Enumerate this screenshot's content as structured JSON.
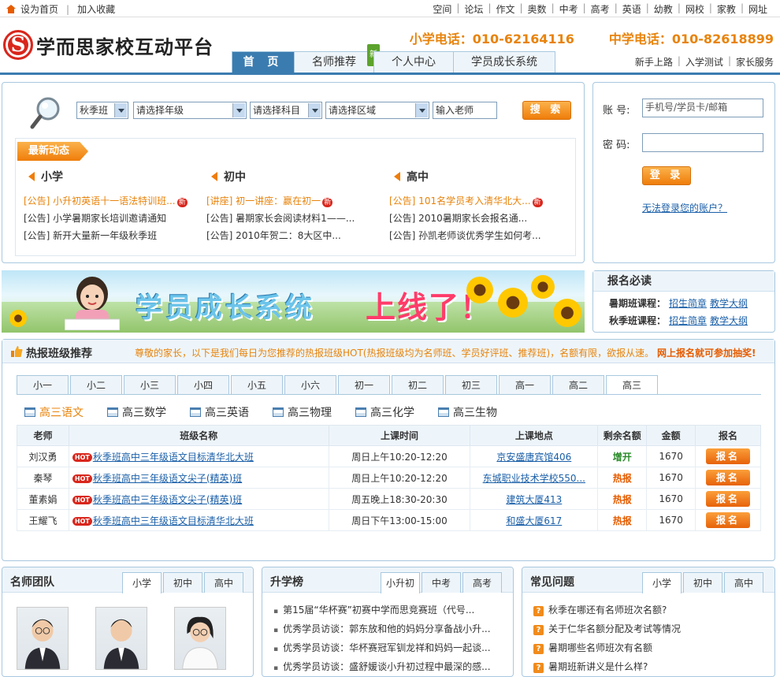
{
  "topbar": {
    "set_home": "设为首页",
    "separator": "|",
    "add_favorite": "加入收藏",
    "links": [
      "空间",
      "论坛",
      "作文",
      "奥数",
      "中考",
      "高考",
      "英语",
      "幼教",
      "网校",
      "家教",
      "网址"
    ]
  },
  "header": {
    "logo_text": "学而思家校互动平台",
    "logo_letter": "S",
    "phone_primary": "小学电话：010-62164116",
    "phone_middle": "中学电话：010-82618899",
    "nav": [
      {
        "label": "首 页",
        "active": true
      },
      {
        "label": "名师推荐",
        "badge": "新"
      },
      {
        "label": "个人中心"
      },
      {
        "label": "学员成长系统"
      }
    ],
    "help_links": [
      "新手上路",
      "入学测试",
      "家长服务"
    ]
  },
  "search": {
    "term": "秋季班",
    "grade": "请选择年级",
    "subject": "请选择科目",
    "region": "请选择区域",
    "teacher_placeholder": "输入老师",
    "button": "搜 索"
  },
  "news": {
    "label": "最新动态",
    "columns": [
      {
        "title": "小学",
        "items": [
          {
            "text": "[公告] 小升初英语十一语法特训班...",
            "highlight": true,
            "new": true
          },
          {
            "text": "[公告] 小学暑期家长培训邀请通知"
          },
          {
            "text": "[公告] 新开大量新一年级秋季班"
          }
        ]
      },
      {
        "title": "初中",
        "items": [
          {
            "text": "[讲座] 初一讲座：赢在初一",
            "highlight": true,
            "new": true
          },
          {
            "text": "[公告] 暑期家长会阅读材料1——..."
          },
          {
            "text": "[公告] 2010年贺二：8大区中..."
          }
        ]
      },
      {
        "title": "高中",
        "items": [
          {
            "text": "[公告] 101名学员考入清华北大...",
            "highlight": true,
            "new": true
          },
          {
            "text": "[公告] 2010暑期家长会报名通..."
          },
          {
            "text": "[公告] 孙凯老师谈优秀学生如何考..."
          }
        ]
      }
    ],
    "new_badge": "新"
  },
  "login": {
    "account_label": "账 号:",
    "account_placeholder": "手机号/学员卡/邮箱",
    "password_label": "密 码:",
    "button": "登 录",
    "forgot": "无法登录您的账户？"
  },
  "banner": {
    "title": "学员成长系统",
    "subtitle": "上线了！"
  },
  "signup": {
    "title": "报名必读",
    "rows": [
      {
        "label": "暑期班课程：",
        "link1": "招生简章",
        "link2": "教学大纲"
      },
      {
        "label": "秋季班课程：",
        "link1": "招生简章",
        "link2": "教学大纲"
      }
    ]
  },
  "hot": {
    "title": "热报班级推荐",
    "notice": "尊敬的家长，以下是我们每日为您推荐的热报班级HOT(热报班级均为名师班、学员好评班、推荐班)，名额有限，欲报从速。",
    "notice_strong": "网上报名就可参加抽奖!",
    "grades": [
      "小一",
      "小二",
      "小三",
      "小四",
      "小五",
      "小六",
      "初一",
      "初二",
      "初三",
      "高一",
      "高二",
      "高三"
    ],
    "active_grade": 11,
    "subjects": [
      "高三语文",
      "高三数学",
      "高三英语",
      "高三物理",
      "高三化学",
      "高三生物"
    ],
    "columns": [
      "老师",
      "班级名称",
      "上课时间",
      "上课地点",
      "剩余名额",
      "金额",
      "报名"
    ],
    "hot_badge": "HOT",
    "rows": [
      {
        "teacher": "刘汉勇",
        "name": "秋季班高中三年级语文目标清华北大班",
        "time": "周日上午10:20-12:20",
        "place": "京安盛唐宾馆406",
        "status": "增开",
        "status_type": "green",
        "price": "1670",
        "action": "报名"
      },
      {
        "teacher": "秦琴",
        "name": "秋季班高中三年级语文尖子(精英)班",
        "time": "周日上午10:20-12:20",
        "place": "东城职业技术学校550...",
        "status": "热报",
        "status_type": "red",
        "price": "1670",
        "action": "报名"
      },
      {
        "teacher": "董素娟",
        "name": "秋季班高中三年级语文尖子(精英)班",
        "time": "周五晚上18:30-20:30",
        "place": "建筑大厦413",
        "status": "热报",
        "status_type": "red",
        "price": "1670",
        "action": "报名"
      },
      {
        "teacher": "王耀飞",
        "name": "秋季班高中三年级语文目标清华北大班",
        "time": "周日下午13:00-15:00",
        "place": "和盛大厦617",
        "status": "热报",
        "status_type": "red",
        "price": "1670",
        "action": "报名"
      }
    ]
  },
  "teachers_panel": {
    "title": "名师团队",
    "tabs": [
      "小学",
      "初中",
      "高中"
    ]
  },
  "ranking_panel": {
    "title": "升学榜",
    "tabs": [
      "小升初",
      "中考",
      "高考"
    ],
    "items": [
      "第15届“华杯赛”初赛中学而思竞赛班（代号...",
      "优秀学员访谈：郭东放和他的妈妈分享备战小升...",
      "优秀学员访谈：华杯赛冠军钏龙祥和妈妈一起谈...",
      "优秀学员访谈：盛舒媛谈小升初过程中最深的感..."
    ]
  },
  "faq_panel": {
    "title": "常见问题",
    "tabs": [
      "小学",
      "初中",
      "高中"
    ],
    "items": [
      "秋季在哪还有名师班次名额?",
      "关于仁华名额分配及考试等情况",
      "暑期哪些名师班次有名额",
      "暑期班新讲义是什么样?"
    ]
  }
}
